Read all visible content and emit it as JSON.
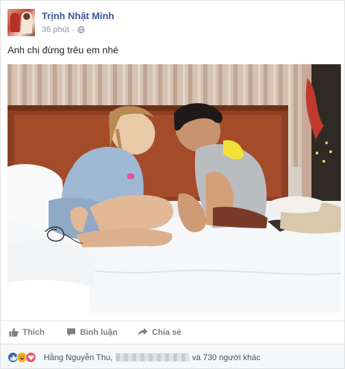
{
  "post": {
    "author": "Trịnh Nhật Minh",
    "time": "36 phút",
    "dot": "·",
    "text": "Anh chị đừng trêu em nhé"
  },
  "actions": {
    "like": "Thích",
    "comment": "Bình luận",
    "share": "Chia sẻ"
  },
  "reactions": {
    "first_name": "Hằng Nguyễn Thu,",
    "others": "và 730 người khác",
    "icons": [
      "like-icon",
      "haha-icon",
      "love-icon"
    ]
  },
  "colors": {
    "author_link": "#365899",
    "like_blue": "#4267b2",
    "muted": "#90949c"
  }
}
